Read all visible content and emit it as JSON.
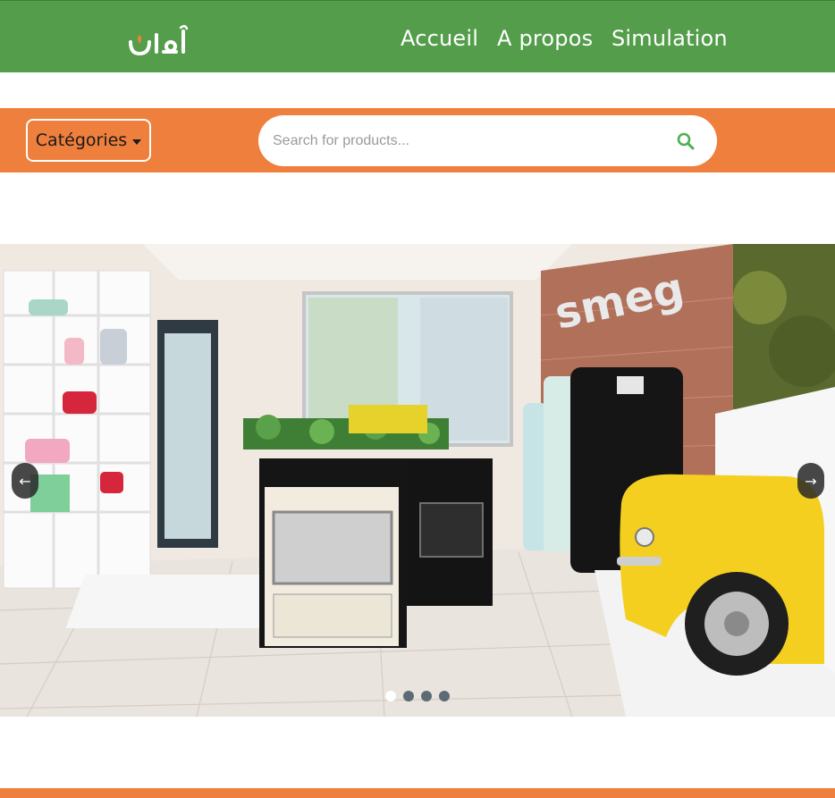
{
  "header": {
    "logo_text": "أمان",
    "nav": [
      {
        "label": "Accueil"
      },
      {
        "label": "A propos"
      },
      {
        "label": "Simulation"
      }
    ]
  },
  "toolbar": {
    "categories_label": "Catégories",
    "search": {
      "placeholder": "Search for products...",
      "value": ""
    }
  },
  "carousel": {
    "prev_label": "←",
    "next_label": "→",
    "slide_count": 4,
    "active_slide": 1,
    "slide_description_icons": [
      "storefront-photo"
    ]
  },
  "colors": {
    "nav_green": "#549d4b",
    "accent_orange": "#ef7f3c",
    "logo_orange": "#ef7f3c",
    "search_icon_green": "#4caf50"
  }
}
